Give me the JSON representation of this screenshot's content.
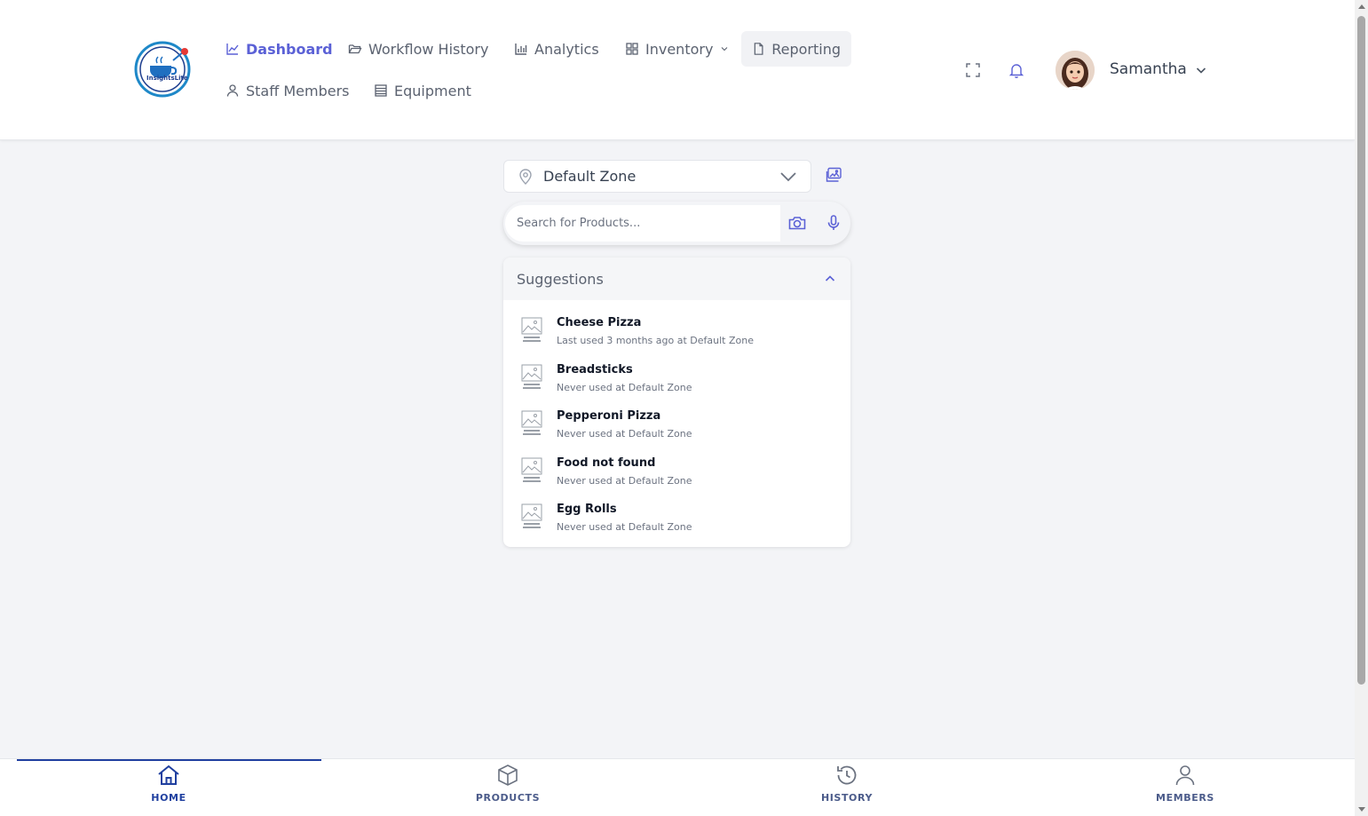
{
  "logo": {
    "text": "InsightsLite"
  },
  "nav": {
    "dashboard": "Dashboard",
    "workflow_history": "Workflow History",
    "analytics": "Analytics",
    "inventory": "Inventory",
    "reporting": "Reporting",
    "staff_members": "Staff Members",
    "equipment": "Equipment"
  },
  "user": {
    "name": "Samantha"
  },
  "zone": {
    "selected": "Default Zone"
  },
  "search": {
    "placeholder": "Search for Products..."
  },
  "suggestions": {
    "title": "Suggestions",
    "items": [
      {
        "name": "Cheese Pizza",
        "sub": "Last used 3 months ago at Default Zone"
      },
      {
        "name": "Breadsticks",
        "sub": "Never used at Default Zone"
      },
      {
        "name": "Pepperoni Pizza",
        "sub": "Never used at Default Zone"
      },
      {
        "name": "Food not found",
        "sub": "Never used at Default Zone"
      },
      {
        "name": "Egg Rolls",
        "sub": "Never used at Default Zone"
      }
    ]
  },
  "bottom_nav": {
    "home": "HOME",
    "products": "PRODUCTS",
    "history": "HISTORY",
    "members": "MEMBERS"
  },
  "colors": {
    "accent": "#5b61d6",
    "primary_dark": "#1f3f9f",
    "background": "#f3f4f7"
  }
}
